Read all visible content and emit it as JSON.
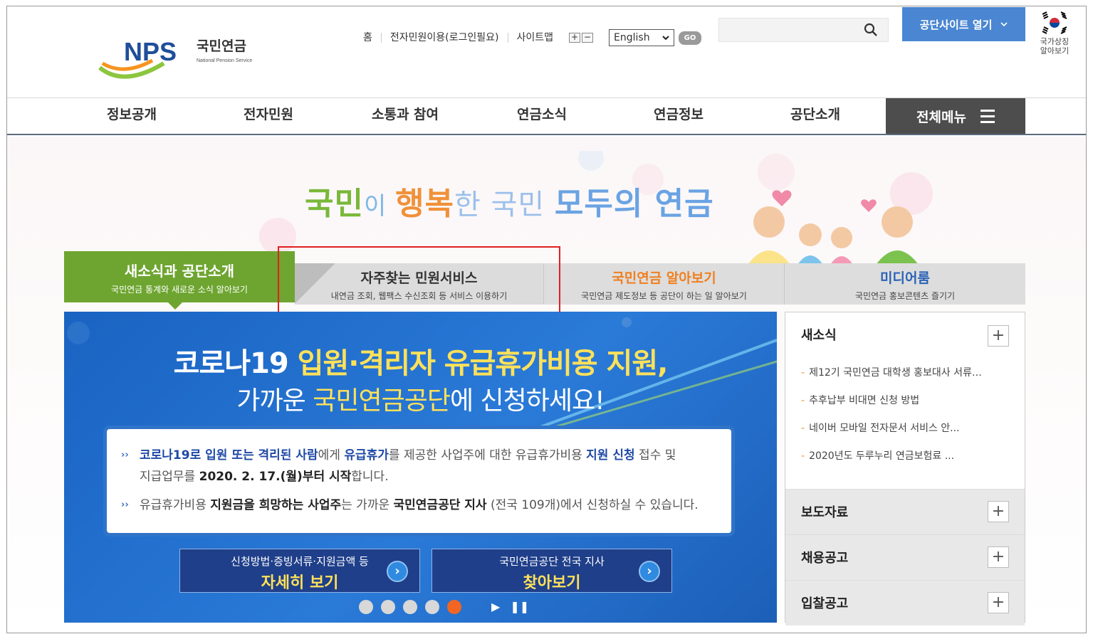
{
  "header": {
    "logo": {
      "mark": "NPS",
      "name_ko": "국민연금",
      "name_en": "National Pension Service"
    },
    "util_links": [
      "홈",
      "전자민원이용(로그인필요)",
      "사이트맵"
    ],
    "zoom": {
      "plus": "+",
      "minus": "−"
    },
    "language": "English",
    "go_label": "GO",
    "search_placeholder": "",
    "site_open_label": "공단사이트 열기",
    "national_symbol": {
      "line1": "국가상징",
      "line2": "알아보기"
    }
  },
  "gnb": {
    "items": [
      "정보공개",
      "전자민원",
      "소통과 참여",
      "연금소식",
      "연금정보",
      "공단소개"
    ],
    "all_menu": "전체메뉴"
  },
  "hero": {
    "slogan": {
      "p1": "국민",
      "p2": "이 ",
      "p3": "행복",
      "p4": "한 국민 ",
      "p5": "모두의 연금"
    }
  },
  "tabs": [
    {
      "title": "새소식과 공단소개",
      "desc": "국민연금 통계와 새로운 소식 알아보기",
      "color": "#6ea530"
    },
    {
      "title": "자주찾는 민원서비스",
      "desc": "내연금 조회, 웹팩스 수신조회 등 서비스 이용하기",
      "color": "#333333"
    },
    {
      "title": "국민연금 알아보기",
      "desc": "국민연금 제도정보 등 공단이 하는 일 알아보기",
      "color": "#f07f1e"
    },
    {
      "title": "미디어룸",
      "desc": "국민연금 홍보콘텐츠 즐기기",
      "color": "#2a63b7"
    }
  ],
  "banner": {
    "line1_a": "코로나19 ",
    "line1_b": "입원·격리자 유급휴가비용 지원,",
    "line2_a": "가까운 ",
    "line2_b": "국민연금공단",
    "line2_c": "에 신청하세요!",
    "item1": {
      "a": "코로나19로 입원 또는 격리된 사람",
      "b": "에게 ",
      "c": "유급휴가",
      "d": "를 제공한 사업주에 대한 유급휴가비용 ",
      "e": "지원 신청",
      "f": " 접수 및",
      "g": "지급업무를 ",
      "h": "2020. 2. 17.(월)부터 시작",
      "i": "합니다."
    },
    "item2": {
      "a": "유급휴가비용 ",
      "b": "지원금을 희망하는 사업주",
      "c": "는 가까운 ",
      "d": "국민연금공단 지사",
      "e": " (전국 109개)에서 신청하실 수 있습니다."
    },
    "btn1": {
      "sub": "신청방법·증빙서류·지원금액 등",
      "main": "자세히 보기"
    },
    "btn2": {
      "sub": "국민연금공단 전국 지사",
      "main": "찾아보기"
    },
    "active_slide": 5,
    "slide_count": 5
  },
  "right_panel": {
    "news_title": "새소식",
    "news": [
      "제12기 국민연금 대학생 홍보대사 서류…",
      "추후납부 비대면 신청 방법",
      "네이버 모바일 전자문서 서비스 안...",
      "2020년도 두루누리 연금보험료 ..."
    ],
    "sections": [
      "보도자료",
      "채용공고",
      "입찰공고"
    ]
  }
}
